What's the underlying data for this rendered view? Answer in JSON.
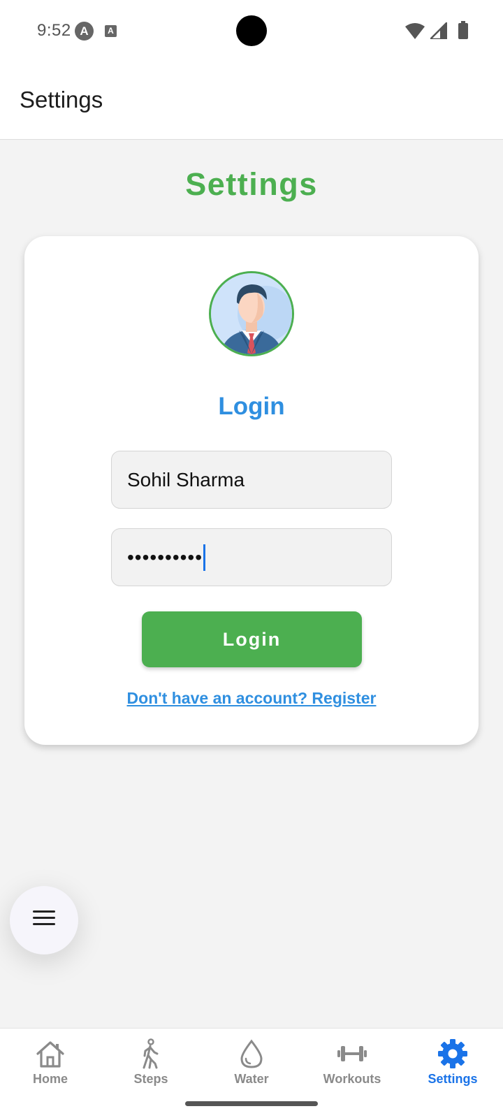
{
  "status_bar": {
    "time": "9:52",
    "app_icon": "A",
    "notification_icon": "A"
  },
  "app_bar": {
    "title": "Settings"
  },
  "main": {
    "heading": "Settings",
    "card": {
      "login_heading": "Login",
      "username_value": "Sohil Sharma",
      "password_masked": "••••••••••",
      "login_button": "Login",
      "register_link": "Don't have an account? Register"
    }
  },
  "bottom_nav": {
    "items": [
      {
        "label": "Home",
        "icon": "home-icon",
        "active": false
      },
      {
        "label": "Steps",
        "icon": "walking-icon",
        "active": false
      },
      {
        "label": "Water",
        "icon": "water-drop-icon",
        "active": false
      },
      {
        "label": "Workouts",
        "icon": "dumbbell-icon",
        "active": false
      },
      {
        "label": "Settings",
        "icon": "gear-icon",
        "active": true
      }
    ]
  },
  "colors": {
    "accent_green": "#4caf50",
    "accent_blue": "#2f8fe0",
    "active_nav": "#1a73e8",
    "inactive_nav": "#8a8a8a"
  }
}
